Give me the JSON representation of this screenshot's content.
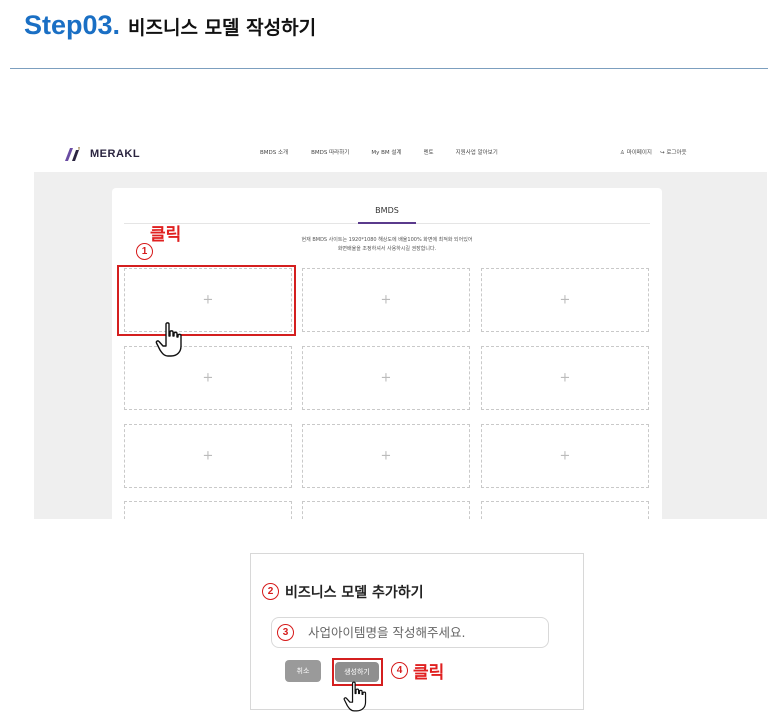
{
  "header": {
    "step_number": "Step03.",
    "step_title": "비즈니스 모델 작성하기"
  },
  "app": {
    "logo_text": "MERAKL",
    "menu": [
      "BMDS 소개",
      "BMDS 따라하기",
      "My BM 설계",
      "멘토",
      "지원사업 알아보기"
    ],
    "user_links": [
      "마이페이지",
      "로그아웃"
    ],
    "active_tab": "BMDS",
    "notice_line1": "현재 BMDS 사이트는 1920*1080 해상도에 배율100% 화면에 최적화 되어있어",
    "notice_line2": "화면배율을 조정하셔서 사용하시길 권장합니다.",
    "card_symbol": "+"
  },
  "annotations": {
    "click_label": "클릭",
    "step1": "1",
    "step2": "2",
    "step3": "3",
    "step4": "4",
    "highlight_color": "#d41f1f"
  },
  "modal": {
    "title": "비즈니스 모델 추가하기",
    "input_placeholder": "사업아이템명을 작성해주세요.",
    "cancel_label": "취소",
    "create_label": "생성하기"
  },
  "colors": {
    "step_blue": "#1a6fc4",
    "brand_purple": "#5a3a8c"
  }
}
